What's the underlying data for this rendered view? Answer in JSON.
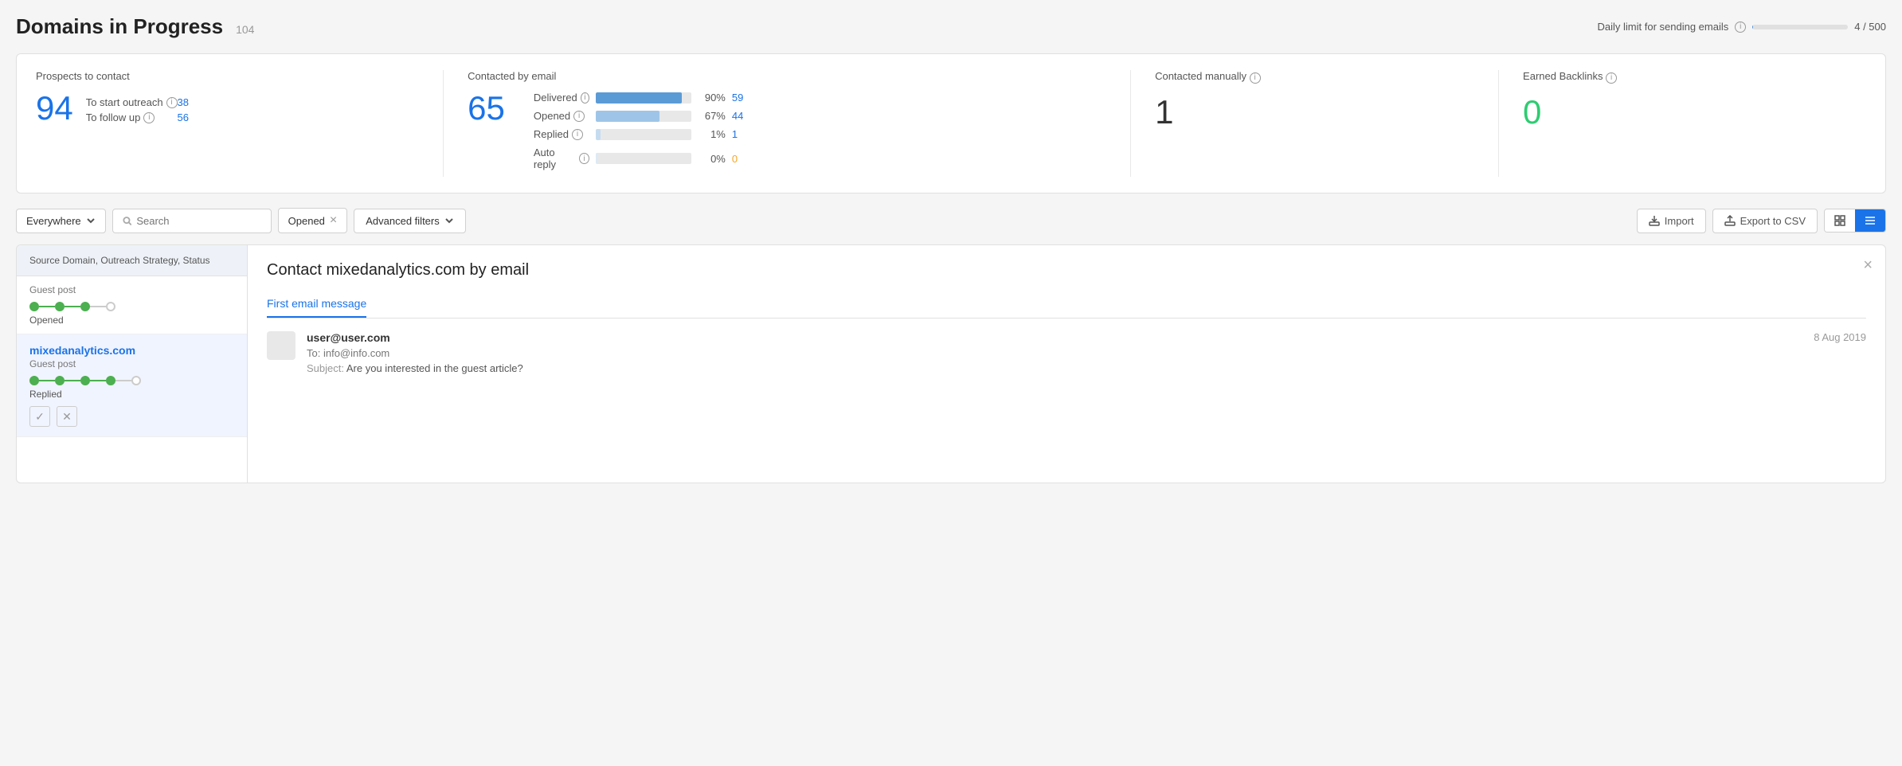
{
  "header": {
    "title": "Domains in Progress",
    "count": "104",
    "daily_limit_label": "Daily limit for sending emails",
    "daily_limit_value": "4 / 500",
    "daily_limit_pct": 0.8
  },
  "stats": {
    "prospects": {
      "title": "Prospects to contact",
      "total": "94",
      "rows": [
        {
          "label": "To start outreach",
          "value": "38"
        },
        {
          "label": "To follow up",
          "value": "56"
        }
      ]
    },
    "contacted_email": {
      "title": "Contacted by email",
      "total": "65",
      "rows": [
        {
          "label": "Delivered",
          "pct": "90%",
          "value": "59",
          "bar_pct": 90,
          "bar_style": "normal"
        },
        {
          "label": "Opened",
          "pct": "67%",
          "value": "44",
          "bar_pct": 67,
          "bar_style": "light"
        },
        {
          "label": "Replied",
          "pct": "1%",
          "value": "1",
          "bar_pct": 5,
          "bar_style": "lighter"
        },
        {
          "label": "Auto reply",
          "pct": "0%",
          "value": "0",
          "bar_pct": 3,
          "bar_style": "lightest",
          "value_color": "orange"
        }
      ]
    },
    "contacted_manually": {
      "title": "Contacted manually",
      "value": "1"
    },
    "earned_backlinks": {
      "title": "Earned Backlinks",
      "value": "0"
    }
  },
  "filters": {
    "location_label": "Everywhere",
    "search_placeholder": "Search",
    "active_filter": "Opened",
    "advanced_filters_label": "Advanced filters",
    "import_label": "Import",
    "export_label": "Export to CSV"
  },
  "left_panel": {
    "header": "Source Domain, Outreach Strategy, Status",
    "partial_item": {
      "label": "Guest post",
      "status": "Opened"
    },
    "active_item": {
      "domain": "mixedanalytics.com",
      "type": "Guest post",
      "status": "Replied",
      "dots": [
        true,
        true,
        true,
        true,
        false
      ]
    }
  },
  "right_panel": {
    "title": "Contact mixedanalytics.com by email",
    "close_label": "×",
    "tabs": [
      {
        "label": "First email message",
        "active": true
      }
    ],
    "email": {
      "from": "user@user.com",
      "to": "info@info.com",
      "date": "8 Aug 2019",
      "subject_label": "Subject:",
      "subject": "Are you interested in the guest article?"
    }
  }
}
